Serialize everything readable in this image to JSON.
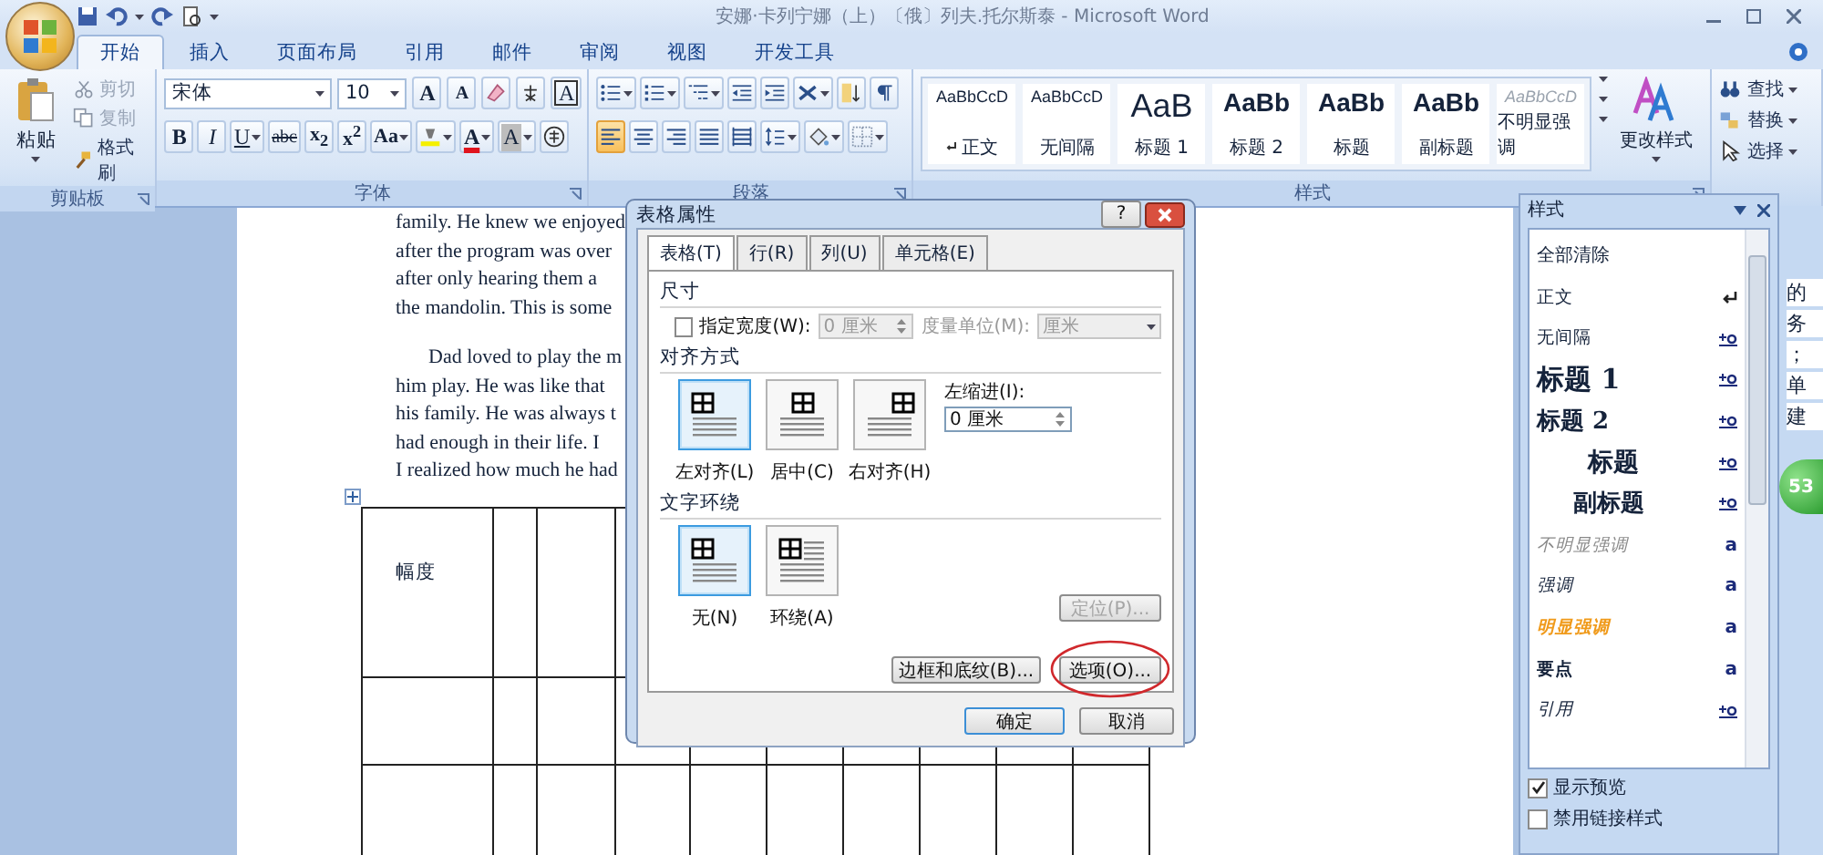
{
  "window": {
    "title": "安娜·卡列宁娜（上）〔俄〕列夫.托尔斯泰 - Microsoft Word"
  },
  "ribbon_tabs": [
    {
      "label": "开始",
      "selected": true
    },
    {
      "label": "插入",
      "selected": false
    },
    {
      "label": "页面布局",
      "selected": false
    },
    {
      "label": "引用",
      "selected": false
    },
    {
      "label": "邮件",
      "selected": false
    },
    {
      "label": "审阅",
      "selected": false
    },
    {
      "label": "视图",
      "selected": false
    },
    {
      "label": "开发工具",
      "selected": false
    }
  ],
  "clipboard": {
    "label": "剪贴板",
    "paste": "粘贴",
    "small": [
      {
        "kind": "cut",
        "label": "剪切",
        "disabled": true
      },
      {
        "kind": "copy",
        "label": "复制",
        "disabled": true
      },
      {
        "kind": "brush",
        "label": "格式刷",
        "disabled": false
      }
    ]
  },
  "font": {
    "label": "字体",
    "font_name": "宋体",
    "font_size": "10",
    "row1": [
      {
        "kind": "grow",
        "text": "A"
      },
      {
        "kind": "shrink",
        "text": "A"
      },
      {
        "kind": "clear"
      },
      {
        "kind": "phonetic"
      },
      {
        "kind": "border",
        "text": "A"
      }
    ],
    "row2": [
      {
        "kind": "bold",
        "text": "B"
      },
      {
        "kind": "italic",
        "text": "I"
      },
      {
        "kind": "underline",
        "text": "U"
      },
      {
        "kind": "strike",
        "text": "abc"
      },
      {
        "kind": "sub",
        "text": "x$_{2}$"
      },
      {
        "kind": "sup",
        "text": "x$^{2}$"
      },
      {
        "kind": "case",
        "text": "Aa"
      },
      {
        "kind": "highlight"
      },
      {
        "kind": "color",
        "text": "A"
      },
      {
        "kind": "shading",
        "text": "A"
      },
      {
        "kind": "enclose"
      }
    ]
  },
  "paragraph": {
    "label": "段落",
    "row1": [
      {
        "kind": "bullets"
      },
      {
        "kind": "numbering"
      },
      {
        "kind": "multilevel"
      },
      {
        "kind": "outdent"
      },
      {
        "kind": "indent"
      },
      {
        "kind": "asian"
      },
      {
        "kind": "sort"
      },
      {
        "kind": "marks"
      }
    ],
    "align": [
      {
        "kind": "left",
        "selected": true
      },
      {
        "kind": "center",
        "selected": false
      },
      {
        "kind": "right",
        "selected": false
      },
      {
        "kind": "justify",
        "selected": false
      },
      {
        "kind": "distributed",
        "selected": false
      }
    ],
    "row2": [
      {
        "kind": "spacing"
      },
      {
        "kind": "shading"
      },
      {
        "kind": "borders"
      }
    ]
  },
  "styles": {
    "label": "样式",
    "change": "更改样式",
    "gallery": [
      {
        "kind": "normal",
        "preview": "AaBbCcD",
        "name": "正文",
        "current": true
      },
      {
        "kind": "normal",
        "preview": "AaBbCcD",
        "name": "无间隔",
        "current": false
      },
      {
        "kind": "h1",
        "preview": "AaB",
        "name": "标题 1",
        "current": false
      },
      {
        "kind": "h2",
        "preview": "AaBb",
        "name": "标题 2",
        "current": false
      },
      {
        "kind": "h2",
        "preview": "AaBb",
        "name": "标题",
        "current": false
      },
      {
        "kind": "h2",
        "preview": "AaBb",
        "name": "副标题",
        "current": false
      },
      {
        "kind": "subtle",
        "preview": "AaBbCcD",
        "name": "不明显强调",
        "current": false
      }
    ]
  },
  "editing": [
    {
      "kind": "find",
      "label": "查找"
    },
    {
      "kind": "replace",
      "label": "替换"
    },
    {
      "kind": "select",
      "label": "选择"
    }
  ],
  "document": {
    "paragraphs": [
      {
        "indent": false,
        "lines": [
          "family. He knew we enjoyed",
          "after the program was over",
          "after only hearing them a",
          "the mandolin. This is some"
        ]
      },
      {
        "indent": true,
        "lines": [
          "Dad loved to play the m",
          "him play. He was like that",
          "his family. He was always t",
          "had enough in their life. I",
          "I realized how much he had"
        ]
      }
    ],
    "table": {
      "first_cell": "幅度"
    }
  },
  "dialog": {
    "title": "表格属性",
    "help": "?",
    "tabs": [
      {
        "label": "表格(T)",
        "selected": true
      },
      {
        "label": "行(R)",
        "selected": false
      },
      {
        "label": "列(U)",
        "selected": false
      },
      {
        "label": "单元格(E)",
        "selected": false
      }
    ],
    "size_section": "尺寸",
    "width_checkbox": {
      "label": "指定宽度(W):",
      "checked": false
    },
    "width_value": "0 厘米",
    "unit_label": "度量单位(M):",
    "unit_value": "厘米",
    "align_section": "对齐方式",
    "alignments": [
      {
        "kind": "left",
        "label": "左对齐(L)",
        "selected": true
      },
      {
        "kind": "center",
        "label": "居中(C)",
        "selected": false
      },
      {
        "kind": "right",
        "label": "右对齐(H)",
        "selected": false
      }
    ],
    "indent_label": "左缩进(I):",
    "indent_value": "0 厘米",
    "wrap_section": "文字环绕",
    "wraps": [
      {
        "kind": "none",
        "label": "无(N)",
        "selected": true
      },
      {
        "kind": "around",
        "label": "环绕(A)",
        "selected": false
      }
    ],
    "position_button": {
      "label": "定位(P)...",
      "disabled": true
    },
    "borders_button": {
      "label": "边框和底纹(B)..."
    },
    "options_button": {
      "label": "选项(O)...",
      "circled": true
    },
    "ok": "确定",
    "cancel": "取消"
  },
  "styles_pane": {
    "title": "样式",
    "items": [
      {
        "kind": "clear",
        "name": "全部清除"
      },
      {
        "kind": "normal",
        "name": "正文"
      },
      {
        "kind": "nospacing",
        "name": "无间隔"
      },
      {
        "kind": "h1",
        "name": "标题 1"
      },
      {
        "kind": "h2",
        "name": "标题 2"
      },
      {
        "kind": "title",
        "name": "标题"
      },
      {
        "kind": "subtitle",
        "name": "副标题"
      },
      {
        "kind": "subtle",
        "name": "不明显强调",
        "badge": "a"
      },
      {
        "kind": "emphasis",
        "name": "强调",
        "badge": "a"
      },
      {
        "kind": "intense",
        "name": "明显强调",
        "badge": "a"
      },
      {
        "kind": "strong",
        "name": "要点",
        "badge": "a"
      },
      {
        "kind": "quote",
        "name": "引用"
      }
    ],
    "options": [
      {
        "label": "显示预览",
        "checked": true
      },
      {
        "label": "禁用链接样式",
        "checked": false
      }
    ]
  },
  "side_pane": {
    "fragments": [
      "的",
      "务",
      "；",
      "单",
      "建"
    ]
  },
  "floating_badge": "53"
}
